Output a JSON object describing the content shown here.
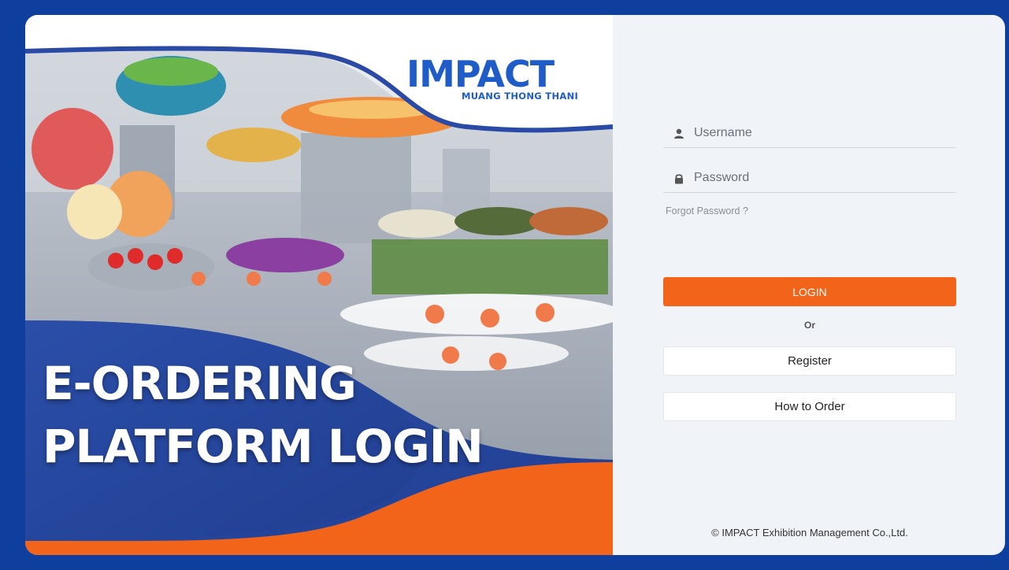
{
  "logo": {
    "word": "IMPACT",
    "subtitle": "MUANG THONG THANI"
  },
  "hero": {
    "title_line1": "E-ORDERING",
    "title_line2": "PLATFORM LOGIN"
  },
  "form": {
    "username_placeholder": "Username",
    "password_placeholder": "Password",
    "forgot_label": "Forgot Password ?",
    "login_label": "LOGIN",
    "or_label": "Or",
    "register_label": "Register",
    "how_to_order_label": "How to Order"
  },
  "footer": {
    "copyright": "© IMPACT Exhibition Management Co.,Ltd."
  },
  "colors": {
    "page_background": "#0f3f9e",
    "brand_blue": "#1f5cc8",
    "hero_navy": "#2a4aa6",
    "accent_orange": "#f26419",
    "form_background": "#f0f3f8"
  },
  "icons": {
    "username": "user-icon",
    "password": "lock-icon"
  }
}
